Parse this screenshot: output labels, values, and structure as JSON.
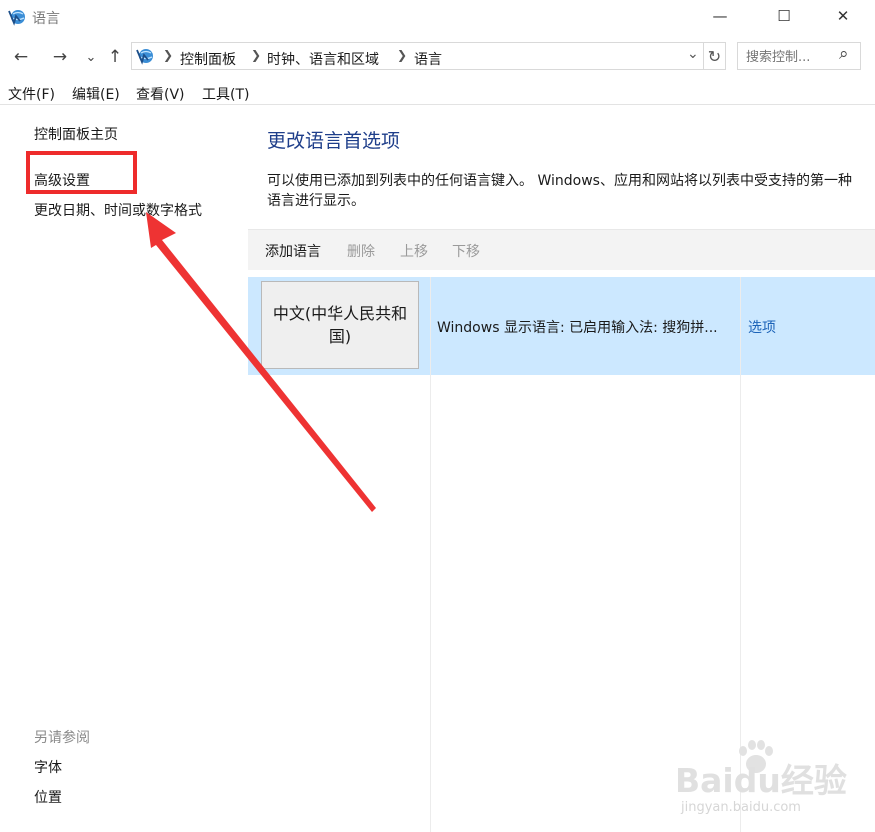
{
  "window": {
    "title": "语言",
    "controls": {
      "minimize": "—",
      "maximize": "☐",
      "close": "✕"
    }
  },
  "nav": {
    "back": "←",
    "forward": "→",
    "recent": "⌄",
    "up": "↑",
    "breadcrumb": [
      "控制面板",
      "时钟、语言和区域",
      "语言"
    ],
    "dropdown": "⌄",
    "refresh": "↻",
    "search_placeholder": "搜索控制...",
    "search_icon": "⌕"
  },
  "menu": [
    "文件(F)",
    "编辑(E)",
    "查看(V)",
    "工具(T)"
  ],
  "sidebar": {
    "home": "控制面板主页",
    "advanced": "高级设置",
    "date_format": "更改日期、时间或数字格式",
    "see_also": "另请参阅",
    "fonts": "字体",
    "location": "位置"
  },
  "main": {
    "heading": "更改语言首选项",
    "description": "可以使用已添加到列表中的任何语言键入。 Windows、应用和网站将以列表中受支持的第一种语言进行显示。",
    "toolbar": {
      "add": "添加语言",
      "remove": "删除",
      "up": "上移",
      "down": "下移"
    },
    "language": {
      "name": "中文(中华人民共和国)",
      "status": "Windows 显示语言: 已启用输入法: 搜狗拼...",
      "options": "选项"
    }
  },
  "watermark": {
    "brand": "Baidu经验",
    "url": "jingyan.baidu.com"
  },
  "colors": {
    "accent_blue": "#1c63b8",
    "heading_blue": "#1e3e8a",
    "selection": "#cce8ff",
    "annotation_red": "#ee2b2b",
    "disabled": "#9a9a9a"
  }
}
